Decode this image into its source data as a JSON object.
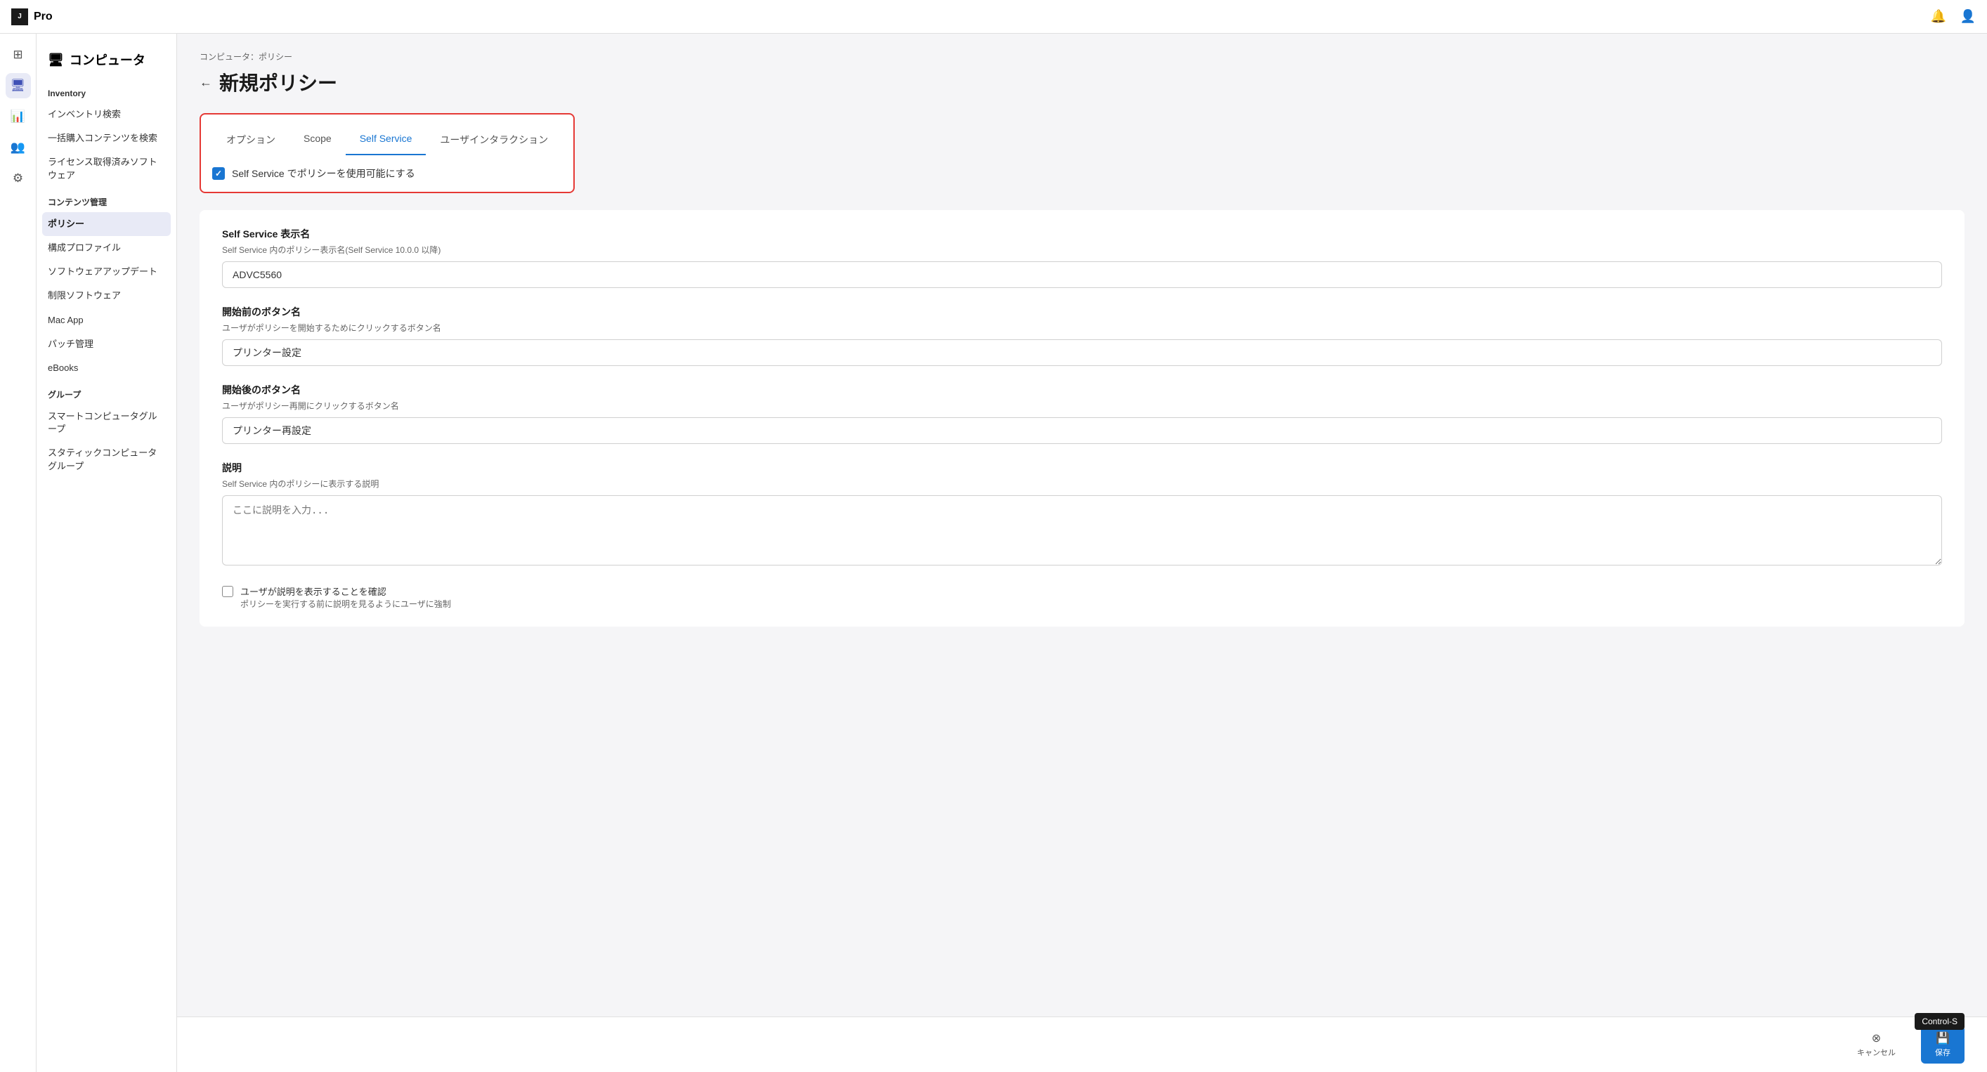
{
  "topbar": {
    "logo_text": "Pro",
    "notification_icon": "🔔",
    "user_icon": "👤"
  },
  "icon_nav": {
    "items": [
      {
        "icon": "⊞",
        "name": "dashboard",
        "active": false
      },
      {
        "icon": "🖥",
        "name": "computers",
        "active": true
      },
      {
        "icon": "📊",
        "name": "reports",
        "active": false
      },
      {
        "icon": "👥",
        "name": "users",
        "active": false
      },
      {
        "icon": "⚙",
        "name": "settings",
        "active": false
      }
    ]
  },
  "sidebar": {
    "title": "コンピュータ",
    "sections": [
      {
        "label": "Inventory",
        "items": [
          {
            "label": "インベントリ検索",
            "active": false
          },
          {
            "label": "一括購入コンテンツを検索",
            "active": false
          },
          {
            "label": "ライセンス取得済みソフトウェア",
            "active": false
          }
        ]
      },
      {
        "label": "コンテンツ管理",
        "items": [
          {
            "label": "ポリシー",
            "active": true
          },
          {
            "label": "構成プロファイル",
            "active": false
          },
          {
            "label": "ソフトウェアアップデート",
            "active": false
          },
          {
            "label": "制限ソフトウェア",
            "active": false
          },
          {
            "label": "Mac App",
            "active": false
          },
          {
            "label": "パッチ管理",
            "active": false
          },
          {
            "label": "eBooks",
            "active": false
          }
        ]
      },
      {
        "label": "グループ",
        "items": [
          {
            "label": "スマートコンピュータグループ",
            "active": false
          },
          {
            "label": "スタティックコンピュータグループ",
            "active": false
          }
        ]
      }
    ]
  },
  "breadcrumb": "コンピュータ：ポリシー",
  "page_title": "新規ポリシー",
  "back_label": "←",
  "tabs": [
    {
      "label": "オプション",
      "active": false
    },
    {
      "label": "Scope",
      "active": false
    },
    {
      "label": "Self Service",
      "active": true
    },
    {
      "label": "ユーザインタラクション",
      "active": false
    }
  ],
  "self_service_checkbox": {
    "label": "Self Service でポリシーを使用可能にする",
    "checked": true
  },
  "form": {
    "display_name": {
      "label": "Self Service 表示名",
      "sublabel": "Self Service 内のポリシー表示名(Self Service 10.0.0 以降)",
      "value": "ADVC5560"
    },
    "before_button": {
      "label": "開始前のボタン名",
      "sublabel": "ユーザがポリシーを開始するためにクリックするボタン名",
      "value": "プリンター設定"
    },
    "after_button": {
      "label": "開始後のボタン名",
      "sublabel": "ユーザがポリシー再開にクリックするボタン名",
      "value": "プリンター再設定"
    },
    "description": {
      "label": "説明",
      "sublabel": "Self Service 内のポリシーに表示する説明",
      "placeholder": "ここに説明を入力..."
    },
    "confirm_checkbox": {
      "label": "ユーザが説明を表示することを確認",
      "sublabel": "ポリシーを実行する前に説明を見るようにユーザに強制"
    }
  },
  "bottom": {
    "cancel_label": "キャンセル",
    "save_label": "保存",
    "tooltip": "Control-S"
  }
}
